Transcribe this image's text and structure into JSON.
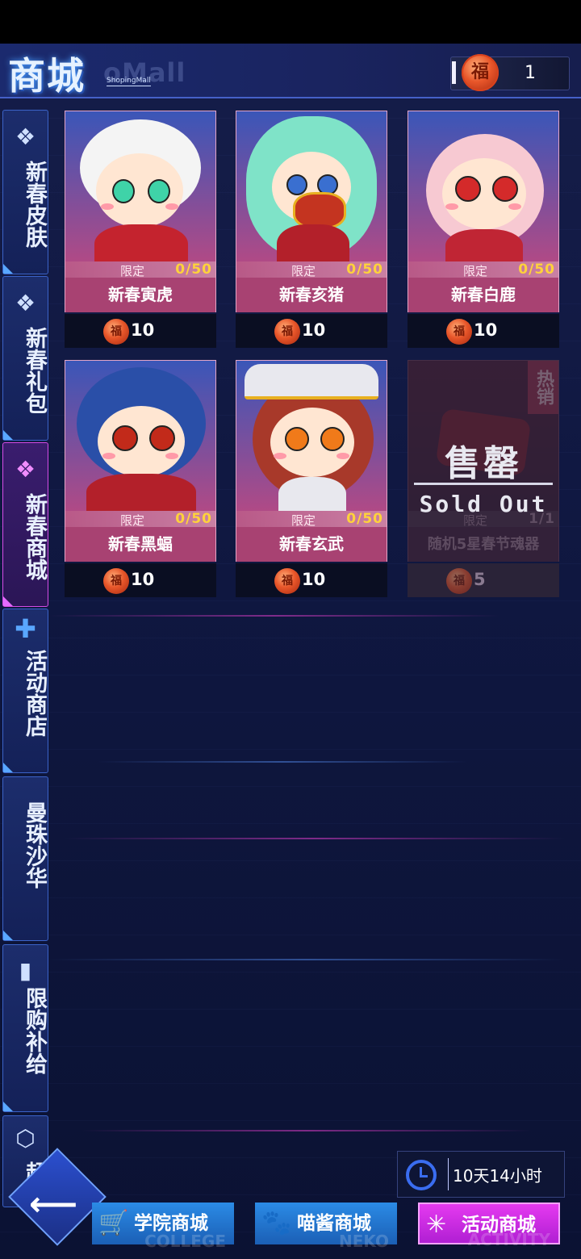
{
  "header": {
    "title": "商城",
    "title_en": "oMall",
    "title_sub": "ShopingMall",
    "currency_icon": "fu-coin-icon",
    "currency_amount": "1"
  },
  "sidebar": {
    "tabs": [
      {
        "label": "新春皮肤",
        "icon": "chinese-knot-icon",
        "active": false
      },
      {
        "label": "新春礼包",
        "icon": "chinese-knot-icon",
        "active": false
      },
      {
        "label": "新春商城",
        "icon": "chinese-knot-icon",
        "active": true
      },
      {
        "label": "活动商店",
        "icon": "plus-icon",
        "active": false
      },
      {
        "label": "曼珠沙华",
        "icon": "",
        "active": false
      },
      {
        "label": "限购补给",
        "icon": "battery-icon",
        "active": false
      },
      {
        "label": "超",
        "icon": "cube-icon",
        "active": false
      }
    ]
  },
  "items": [
    {
      "name": "新春寅虎",
      "limit_label": "限定",
      "limit": "0/50",
      "price": "10",
      "hair": "#f4f4f4",
      "eye": "#3fd3a8",
      "outfit": "#c4232e"
    },
    {
      "name": "新春亥猪",
      "limit_label": "限定",
      "limit": "0/50",
      "price": "10",
      "hair": "#7fe3c8",
      "eye": "#3a6fd0",
      "outfit": "#b3202a"
    },
    {
      "name": "新春白鹿",
      "limit_label": "限定",
      "limit": "0/50",
      "price": "10",
      "hair": "#f7c9d2",
      "eye": "#d42a2a",
      "outfit": "#c02534"
    },
    {
      "name": "新春黑蝠",
      "limit_label": "限定",
      "limit": "0/50",
      "price": "10",
      "hair": "#2a4fa8",
      "eye": "#c22a1a",
      "outfit": "#b3202a"
    },
    {
      "name": "新春玄武",
      "limit_label": "限定",
      "limit": "0/50",
      "price": "10",
      "hair": "#a8392a",
      "eye": "#f07a1a",
      "outfit": "#e8e8ee"
    },
    {
      "name": "随机5星春节魂器",
      "limit_label": "限定",
      "limit": "1/1",
      "price": "5",
      "hot": "热销",
      "sold_cn": "售罄",
      "sold_en": "Sold Out"
    }
  ],
  "timer": {
    "icon": "clock-icon",
    "text": "10天14小时"
  },
  "bottom_nav": [
    {
      "label": "学院商城",
      "en": "COLLEGE",
      "icon": "cart-icon"
    },
    {
      "label": "喵酱商城",
      "en": "NEKO",
      "icon": "paw-icon"
    },
    {
      "label": "活动商城",
      "en": "ACTIVITY",
      "icon": "activity-icon",
      "active": true
    }
  ]
}
